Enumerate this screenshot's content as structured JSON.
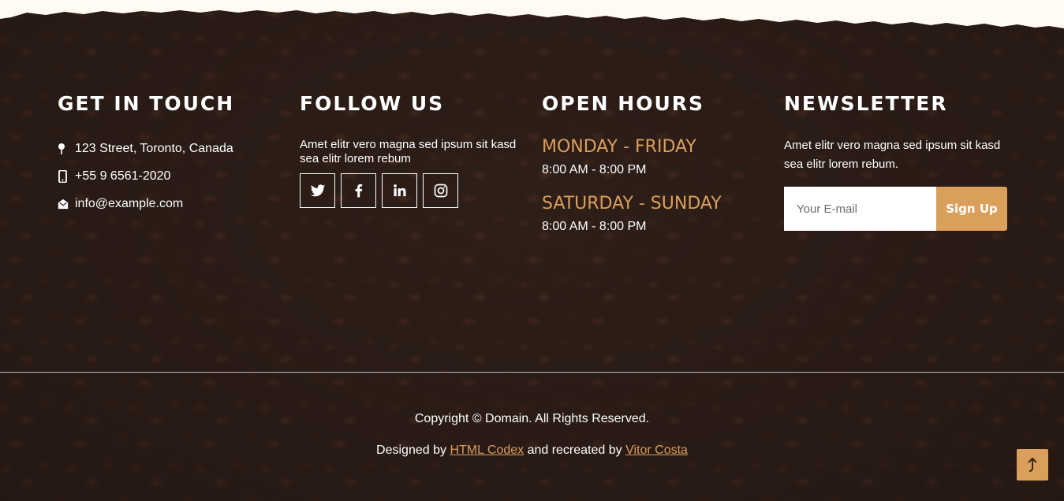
{
  "contact": {
    "heading": "GET IN TOUCH",
    "address": "123 Street, Toronto, Canada",
    "phone": "+55 9 6561-2020",
    "email": "info@example.com",
    "icons": [
      "map-marker-icon",
      "mobile-phone-icon",
      "envelope-open-icon"
    ]
  },
  "follow": {
    "heading": "FOLLOW US",
    "description": "Amet elitr vero magna sed ipsum sit kasd sea elitr lorem rebum",
    "social": [
      "twitter-icon",
      "facebook-icon",
      "linkedin-icon",
      "instagram-icon"
    ]
  },
  "hours": {
    "heading": "OPEN HOURS",
    "weekday_label": "MONDAY - FRIDAY",
    "weekday_time": "8:00 AM - 8:00 PM",
    "weekend_label": "SATURDAY - SUNDAY",
    "weekend_time": "8:00 AM - 8:00 PM"
  },
  "newsletter": {
    "heading": "NEWSLETTER",
    "description": "Amet elitr vero magna sed ipsum sit kasd sea elitr lorem rebum.",
    "placeholder": "Your E-mail",
    "button_label": "Sign Up"
  },
  "copyright": {
    "line1": "Copyright © Domain. All Rights Reserved.",
    "designed_by": "Designed by",
    "link1": "HTML Codex",
    "recreated_by": "and recreated by",
    "link2": "Vitor Costa"
  },
  "back_to_top_icon": "arrow-up-icon",
  "colors": {
    "accent": "#da9f5b",
    "background": "#2f1f19",
    "paper": "#fff8ef"
  }
}
